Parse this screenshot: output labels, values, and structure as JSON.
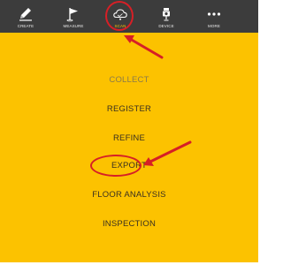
{
  "colors": {
    "background": "#fcc200",
    "toolbar": "#3c3c3c",
    "highlight": "#d61f26",
    "menu_text": "#3a3020",
    "menu_text_dim": "#8a7a4a"
  },
  "toolbar": {
    "items": [
      {
        "label": "CREATE",
        "icon": "pencil-icon"
      },
      {
        "label": "MEASURE",
        "icon": "flag-icon"
      },
      {
        "label": "SCAN",
        "icon": "cloud-scan-icon"
      },
      {
        "label": "DEVICE",
        "icon": "device-icon"
      },
      {
        "label": "MORE",
        "icon": "more-dots-icon"
      }
    ]
  },
  "menu": {
    "items": [
      {
        "label": "COLLECT"
      },
      {
        "label": "REGISTER"
      },
      {
        "label": "REFINE"
      },
      {
        "label": "EXPORT"
      },
      {
        "label": "FLOOR ANALYSIS"
      },
      {
        "label": "INSPECTION"
      }
    ]
  }
}
